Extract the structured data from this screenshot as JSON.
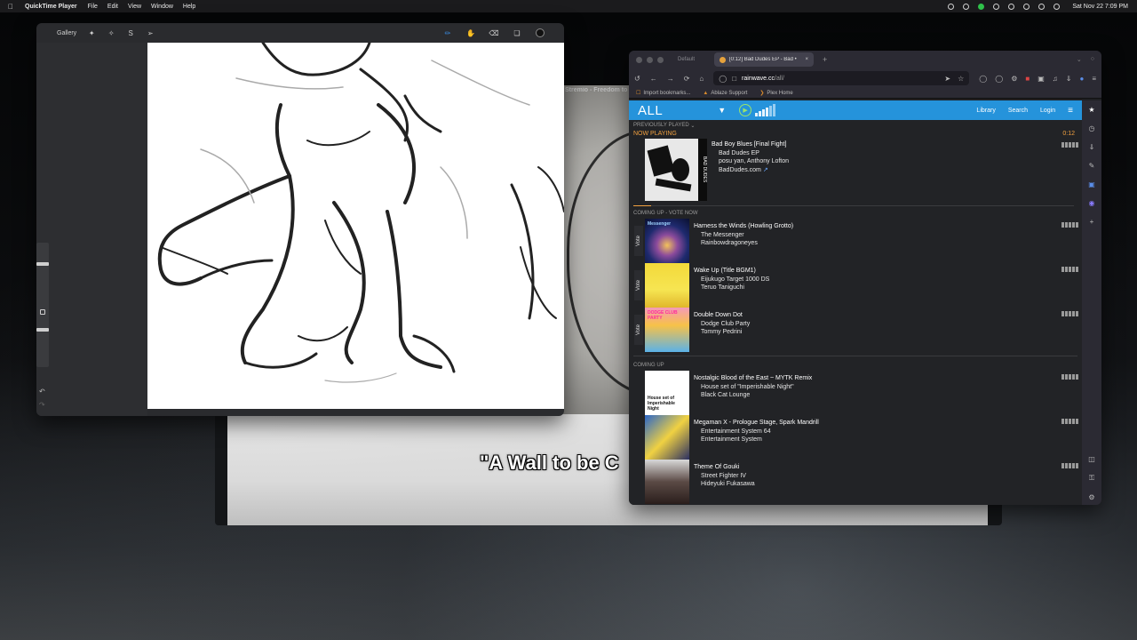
{
  "menubar": {
    "app_name": "QuickTime Player",
    "items": [
      "File",
      "Edit",
      "View",
      "Window",
      "Help"
    ],
    "clock": "Sat Nov 22  7:09 PM"
  },
  "video": {
    "title_strip": "Stremio - Freedom to",
    "subtitle": "\"A Wall to be C"
  },
  "draw_app": {
    "gallery_label": "Gallery"
  },
  "browser": {
    "tabs": [
      {
        "label": "Default"
      },
      {
        "label": "[0:12] Bad Dudes EP - Bad •"
      }
    ],
    "url_main": "rainwave.cc",
    "url_path": "/all/",
    "bookmarks": [
      "Import bookmarks...",
      "Ablaze Support",
      "Plex Home"
    ]
  },
  "site": {
    "station": "ALL",
    "nav": {
      "library": "Library",
      "search": "Search",
      "login": "Login"
    },
    "previously_played": "PREVIOUSLY PLAYED",
    "now_playing_label": "NOW PLAYING",
    "elapsed": "0:12",
    "now_playing": {
      "title": "Bad Boy Blues [Final Fight]",
      "album": "Bad Dudes EP",
      "artists": "posu yan, Anthony Lofton",
      "link": "BadDudes.com"
    },
    "coming_up_vote_label": "COMING UP - VOTE NOW",
    "vote_label": "Vote",
    "vote_songs": [
      {
        "title": "Harness the Winds (Howling Grotto)",
        "album": "The Messenger",
        "artist": "Rainbowdragoneyes"
      },
      {
        "title": "Wake Up (Title BGM1)",
        "album": "Eijukugo Target 1000 DS",
        "artist": "Teruo Taniguchi"
      },
      {
        "title": "Double Down Dot",
        "album": "Dodge Club Party",
        "artist": "Tommy Pedrini"
      }
    ],
    "coming_up_label": "COMING UP",
    "queue_songs": [
      {
        "title": "Nostalgic Blood of the East ~ MYTK Remix",
        "album": "House set of \"Imperishable Night\"",
        "artist": "Black Cat Lounge"
      },
      {
        "title": "Megaman X - Prologue Stage, Spark Mandrill",
        "album": "Entertainment System 64",
        "artist": "Entertainment System"
      },
      {
        "title": "Theme Of Gouki",
        "album": "Street Fighter IV",
        "artist": "Hideyuki Fukasawa"
      }
    ],
    "album_art_text": {
      "bad_dudes": "BAD DUDES",
      "messenger": "Messenger",
      "dodge": "DODGE CLUB PARTY",
      "nostalgic": "House set of Imperishable Night"
    }
  },
  "colors": {
    "site_header": "#2593db",
    "now_playing": "#f0a040",
    "brush_active": "#3a8de3"
  }
}
